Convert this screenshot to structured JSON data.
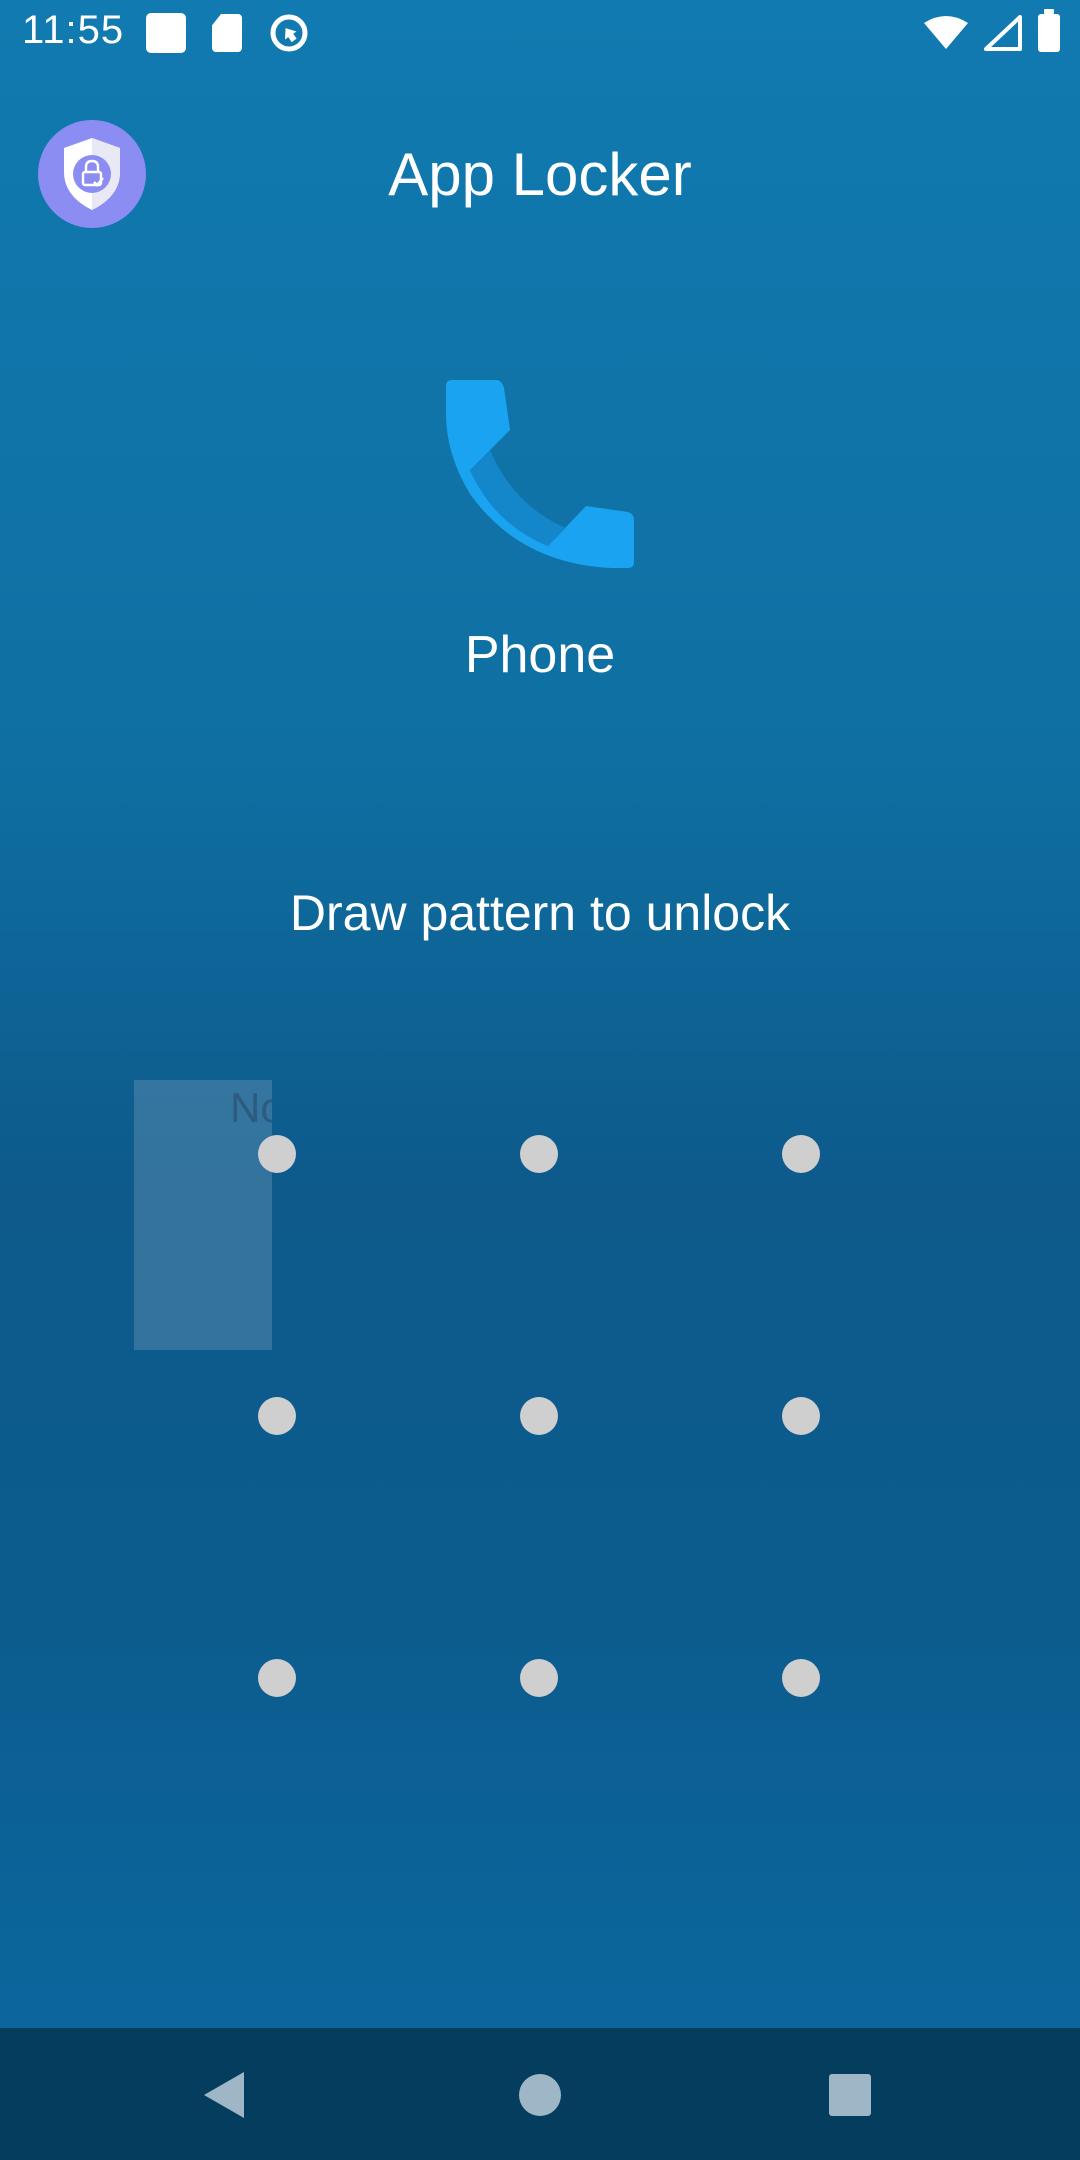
{
  "status_bar": {
    "time": "11:55",
    "left_icons": [
      "square-notification-icon",
      "sd-card-icon",
      "sync-icon"
    ],
    "right_icons": [
      "wifi-icon",
      "cellular-signal-icon",
      "battery-icon"
    ]
  },
  "header": {
    "title": "App Locker",
    "logo_icon": "shield-lock-icon"
  },
  "locked_app": {
    "name": "Phone",
    "icon": "phone-icon"
  },
  "instruction": "Draw pattern to unlock",
  "ghost_overlay_text": "No",
  "pattern": {
    "rows": 3,
    "cols": 3
  },
  "nav_bar": {
    "buttons": [
      "back-icon",
      "home-icon",
      "recents-icon"
    ]
  },
  "colors": {
    "background_top": "#117ab0",
    "background_mid": "#0d5a8b",
    "nav_bar": "#053d5e",
    "logo_bg": "#8c8df2",
    "pattern_dot": "#cfcfcf",
    "phone_icon": "#1aa3f0"
  }
}
